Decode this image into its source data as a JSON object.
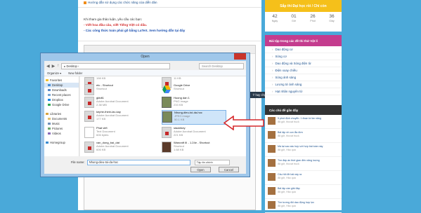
{
  "forum": {
    "link_text": "Hướng dẫn sử dụng các chức năng của diễn đàn",
    "notice_intro": "Khi tham gia thảo luận, yêu cầu các bạn:",
    "notice_line1": "- Viết hoa đầu câu, viết Tiếng Việt có dấu.",
    "notice_line2": "- Các công thức toán phải gõ bằng LaTeX. Xem hướng dẫn tại đây",
    "post_button": "Ý hay chọn"
  },
  "countdown": {
    "title": "Sắp thi Đại học rồi / Chỉ còn",
    "values": [
      "42",
      "01",
      "26",
      "36"
    ],
    "labels": [
      "Ngày",
      "Giờ",
      "Phút",
      "Giây"
    ]
  },
  "topics": {
    "title": "Bài tập trong các đề thi thử Vật lí",
    "items": [
      "Dao động cơ",
      "Sóng cơ",
      "Dao động và Sóng điện từ",
      "Điện xoay chiều",
      "Sóng ánh sáng",
      "Lượng tử ánh sáng",
      "Hạt nhân nguyên tử"
    ]
  },
  "comments": {
    "title": "Các chủ đề gần đây",
    "items": [
      {
        "text": "5 phút định chuyển: 1 đoạn là lần năng",
        "meta": "đã gửi, thuvat truck"
      },
      {
        "text": "Bài tập về con lắc đơn",
        "meta": "đã gửi, thuvat truck"
      },
      {
        "text": "Mà tại sao xác hợp với hợp bài toàn này",
        "meta": "đã gửi, Hảo quá"
      },
      {
        "text": "Tìm đáp án thời gian đến năng lượng",
        "meta": "đã gửi, thuvat truck"
      },
      {
        "text": "Câu hỏi đề bài này ra",
        "meta": "đã gửi, Hảo quá"
      },
      {
        "text": "Bài tập cần giải đáp",
        "meta": "đã gửi, Hảo quá"
      },
      {
        "text": "Tìm tương đối dao động hợp lực",
        "meta": "đã gửi, Hảo quá"
      }
    ]
  },
  "dialog": {
    "title": "Open",
    "close_glyph": "✕",
    "nav_back": "◀",
    "nav_forward": "▶",
    "nav_up": "↑",
    "path": "▸ Desktop ›",
    "search_placeholder": "Search Desktop",
    "organize": "Organize ▾",
    "new_folder": "New folder",
    "nav": {
      "favorites": "Favorites",
      "fav_items": [
        "Desktop",
        "Downloads",
        "Recent places",
        "Dropbox",
        "Google Drive"
      ],
      "libraries": "Libraries",
      "lib_items": [
        "Documents",
        "Music",
        "Pictures",
        "Videos"
      ],
      "homegroup": "Homegroup"
    },
    "files": [
      {
        "name": "",
        "sub": "198 KB",
        "kind": "pdf"
      },
      {
        "name": "",
        "sub": "11 KB",
        "kind": "pdf"
      },
      {
        "name": "etc - Shortcut",
        "sub": "Shortcut",
        "kind": "pdf"
      },
      {
        "name": "Google Drive",
        "sub": "Shortcut",
        "kind": "gd"
      },
      {
        "name": "gktdt1",
        "sub": "Adobe Acrobat Document",
        "sub2": "2.38 MB",
        "kind": "pdf"
      },
      {
        "name": "Huong dan 1",
        "sub": "PNG image",
        "sub2": "233 KB",
        "kind": "img"
      },
      {
        "name": "kephe-thinh-lav-kay",
        "sub": "Adobe Acrobat Document",
        "sub2": "177 KB",
        "kind": "pdf"
      },
      {
        "name": "Nhung-dieu-toi-da-hoc",
        "sub": "JPEG image",
        "sub2": "50.1 KB",
        "kind": "img"
      },
      {
        "name": "Phat viết",
        "sub": "Text Document",
        "sub2": "606 bytes",
        "kind": "pdf"
      },
      {
        "name": "stacktkey",
        "sub": "Adobe Acrobat Document",
        "sub2": "221 KB",
        "kind": "pdf"
      },
      {
        "name": "van_dong_bai_dat",
        "sub": "Adobe Acrobat Document",
        "sub2": "606 KB",
        "kind": "pdf"
      },
      {
        "name": "Warcraft III - 1.24e - Shortcut",
        "sub": "Shortcut",
        "sub2": "1.68 KB",
        "kind": "pdf"
      }
    ],
    "filename_label": "File name:",
    "filename_value": "Nhung-dieu-toi-da-hoc",
    "filetype": "Tập tin chính",
    "open": "Open",
    "cancel": "Cancel"
  }
}
